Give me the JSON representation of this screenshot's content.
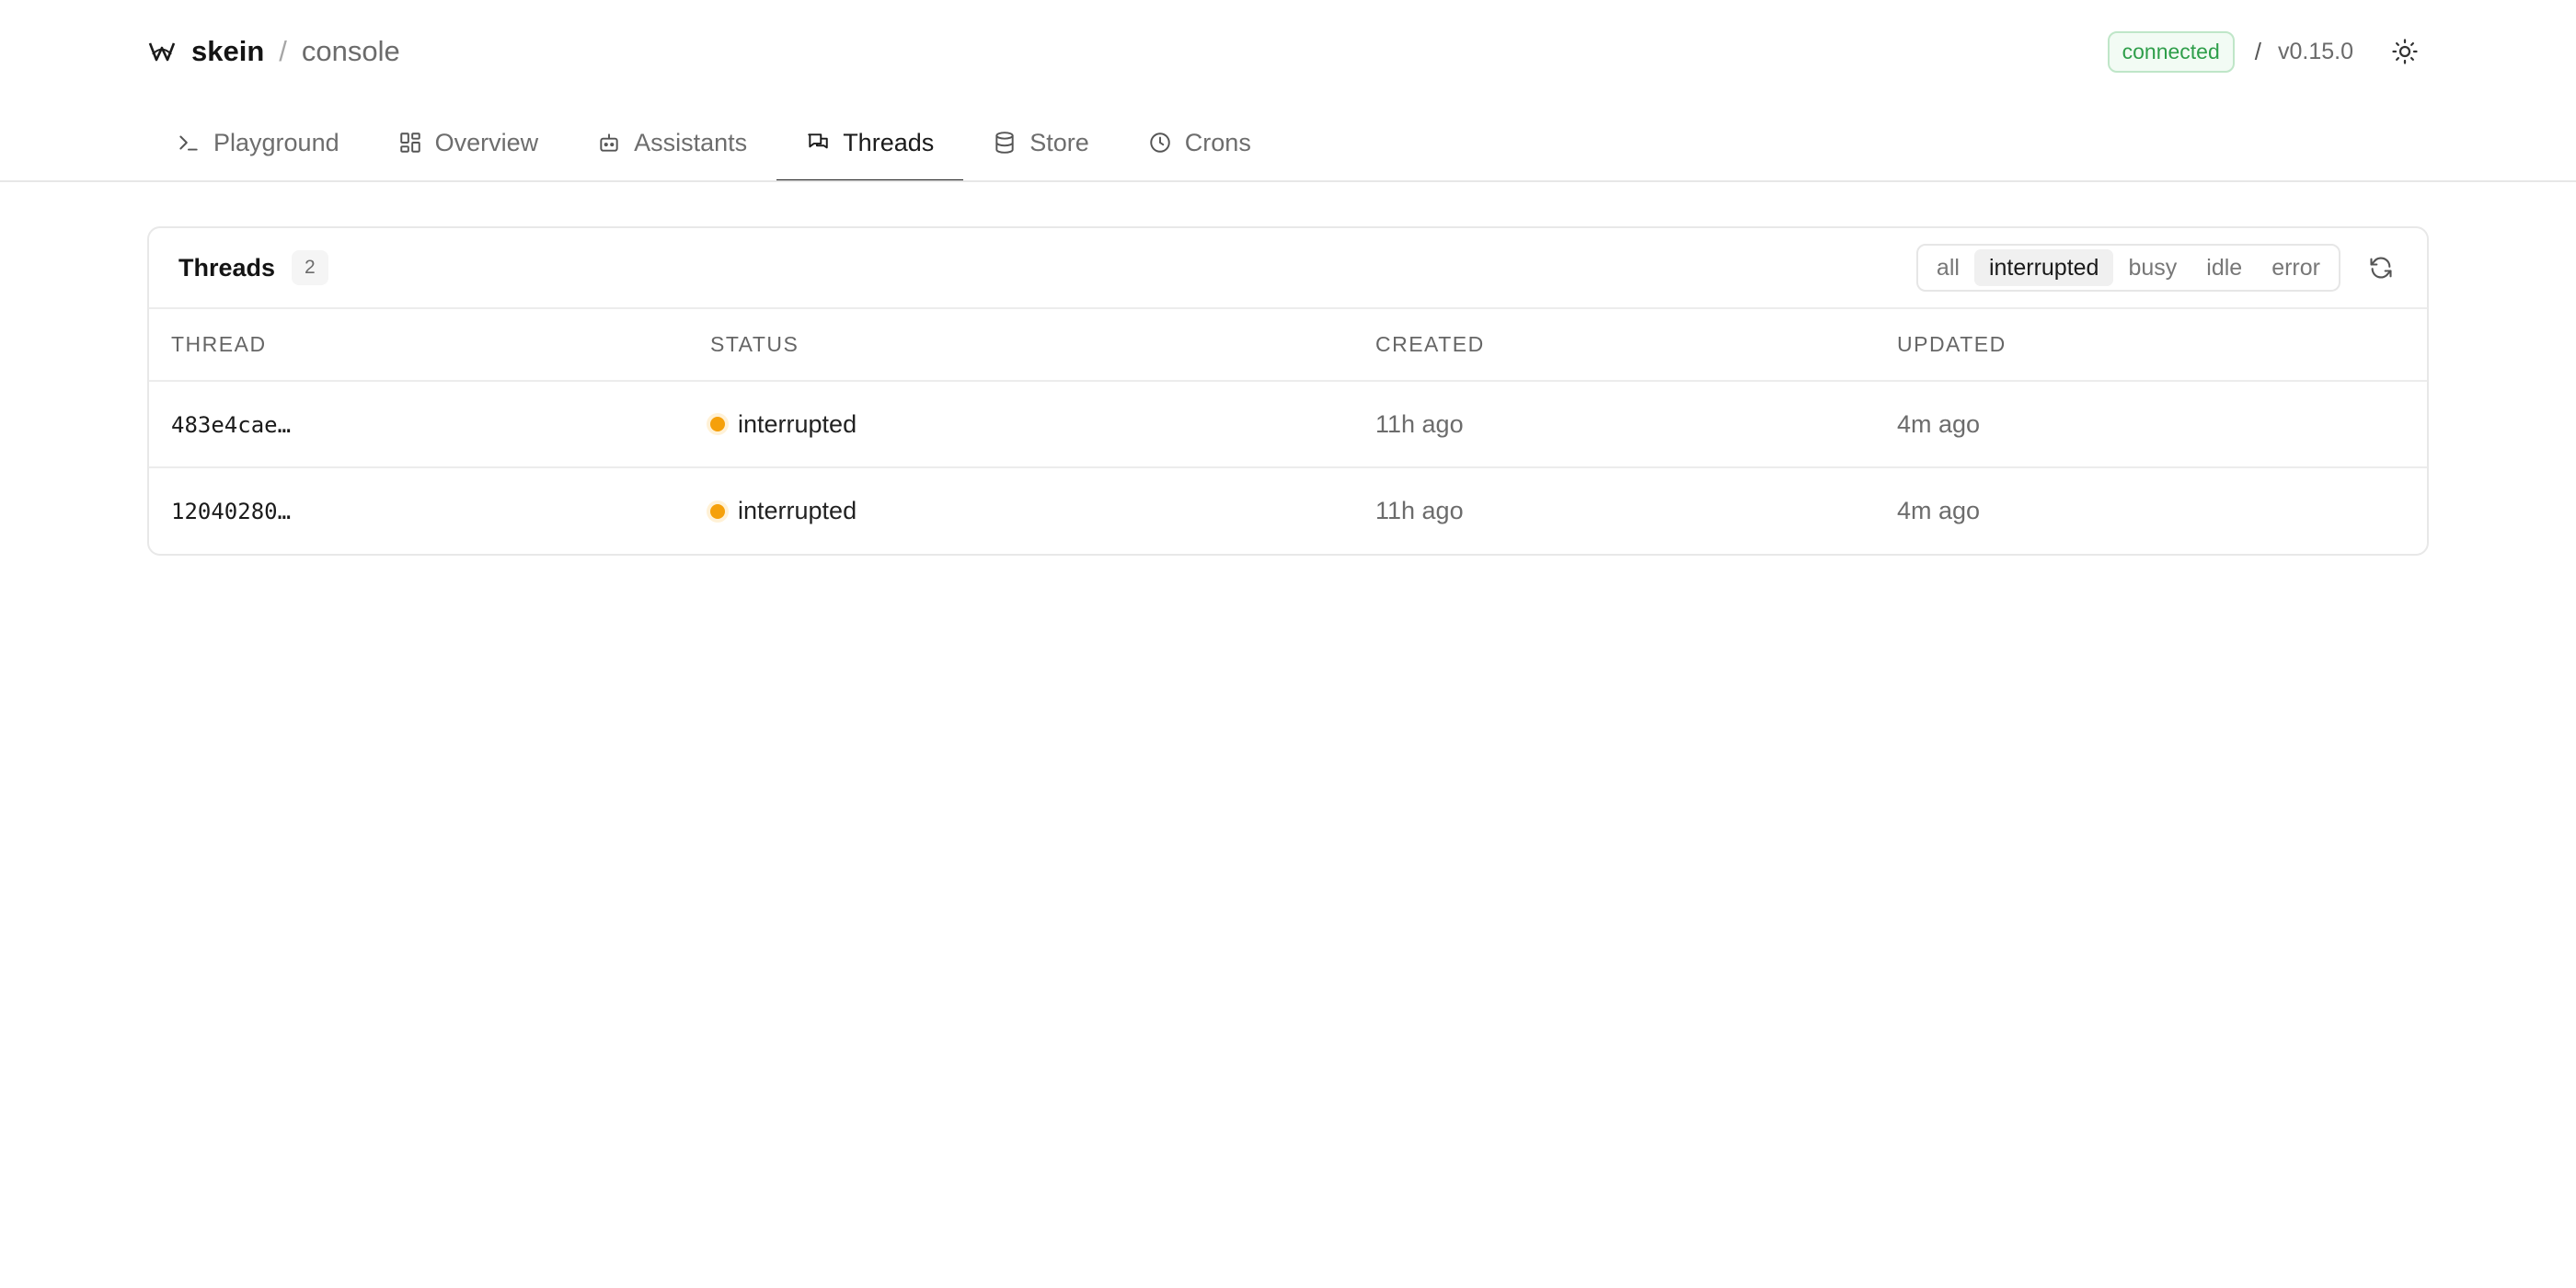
{
  "header": {
    "brand_name": "skein",
    "separator": "/",
    "section": "console",
    "connection_status": "connected",
    "version_separator": "/",
    "version": "v0.15.0",
    "colors": {
      "connected": "#2e9e4a",
      "accent": "#222222"
    }
  },
  "tabs": [
    {
      "label": "Playground",
      "icon": "terminal-icon",
      "active": false
    },
    {
      "label": "Overview",
      "icon": "dashboard-icon",
      "active": false
    },
    {
      "label": "Assistants",
      "icon": "robot-icon",
      "active": false
    },
    {
      "label": "Threads",
      "icon": "chat-icon",
      "active": true
    },
    {
      "label": "Store",
      "icon": "database-icon",
      "active": false
    },
    {
      "label": "Crons",
      "icon": "clock-icon",
      "active": false
    }
  ],
  "threads_card": {
    "title": "Threads",
    "count": "2",
    "filters": [
      {
        "label": "all",
        "active": false
      },
      {
        "label": "interrupted",
        "active": true
      },
      {
        "label": "busy",
        "active": false
      },
      {
        "label": "idle",
        "active": false
      },
      {
        "label": "error",
        "active": false
      }
    ],
    "columns": [
      "Thread",
      "Status",
      "Created",
      "Updated"
    ],
    "rows": [
      {
        "thread": "483e4cae…",
        "status": "interrupted",
        "created": "11h ago",
        "updated": "4m ago"
      },
      {
        "thread": "12040280…",
        "status": "interrupted",
        "created": "11h ago",
        "updated": "4m ago"
      }
    ],
    "status_colors": {
      "interrupted": "#f5a00b"
    }
  }
}
